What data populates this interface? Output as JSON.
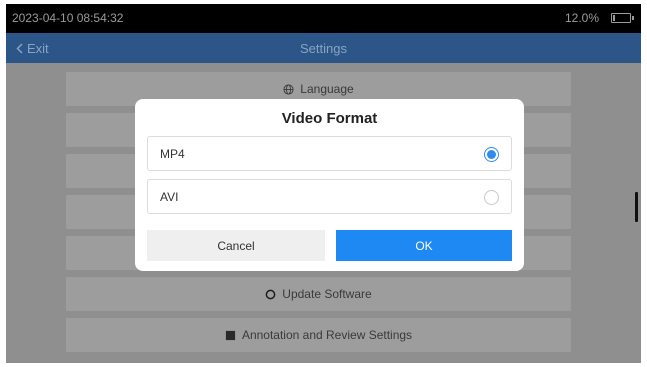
{
  "status_bar": {
    "time": "2023-04-10 08:54:32",
    "battery": "12.0%",
    "battery_level": 0.12
  },
  "title_bar": {
    "back_label": "Exit",
    "title": "Settings"
  },
  "settings_list": [
    {
      "label": "Language",
      "icon": "globe-icon"
    },
    {
      "label": "",
      "icon": ""
    },
    {
      "label": "",
      "icon": ""
    },
    {
      "label": "",
      "icon": ""
    },
    {
      "label": "",
      "icon": ""
    },
    {
      "label": "Update Software",
      "icon": "refresh-icon"
    },
    {
      "label": "Annotation and Review Settings",
      "icon": "note-icon"
    }
  ],
  "dialog": {
    "title": "Video Format",
    "options": [
      {
        "label": "MP4",
        "selected": true
      },
      {
        "label": "AVI",
        "selected": false
      }
    ],
    "cancel_label": "Cancel",
    "ok_label": "OK"
  },
  "colors": {
    "accent": "#1e88f3",
    "title_bar": "#2c5687",
    "dim_overlay": "#8f8f8f"
  }
}
